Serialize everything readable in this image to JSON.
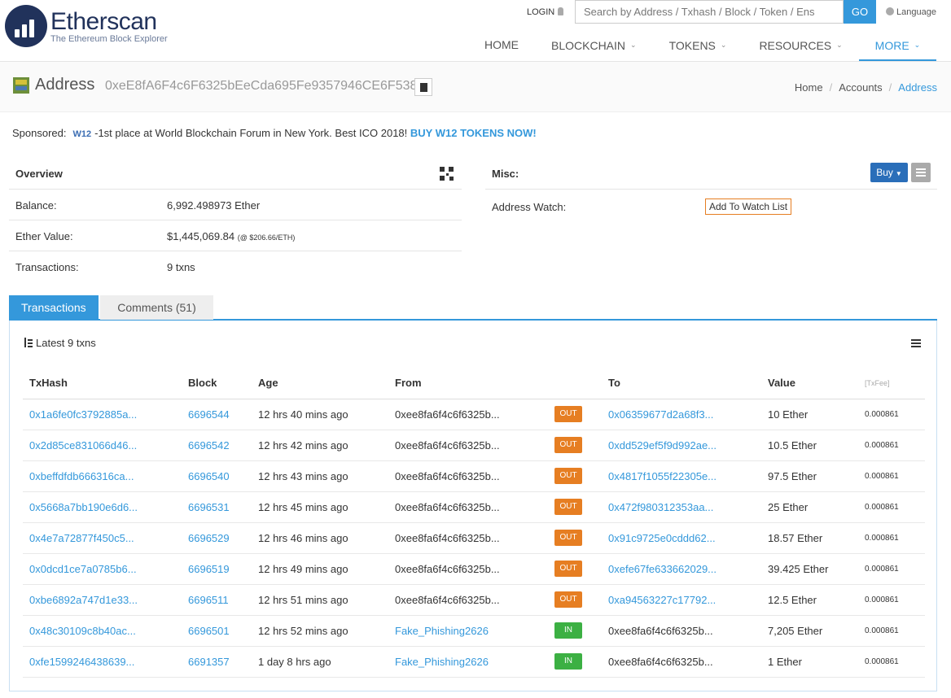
{
  "brand": {
    "name": "Etherscan",
    "tagline": "The Ethereum Block Explorer"
  },
  "header": {
    "login": "LOGIN",
    "search_placeholder": "Search by Address / Txhash / Block / Token / Ens",
    "go": "GO",
    "language": "Language",
    "nav": [
      "HOME",
      "BLOCKCHAIN",
      "TOKENS",
      "RESOURCES",
      "MORE"
    ]
  },
  "title": {
    "label": "Address",
    "hash": "0xeE8fA6F4c6F6325bEeCda695Fe9357946CE6F538",
    "crumbs": [
      "Home",
      "Accounts",
      "Address"
    ]
  },
  "sponsored": {
    "label": "Sponsored:",
    "brand": "W12",
    "text": "-1st place at World Blockchain Forum in New York. Best ICO 2018!",
    "cta": "BUY W12 TOKENS NOW!"
  },
  "overview": {
    "title": "Overview",
    "balance_label": "Balance:",
    "balance_value": "6,992.498973 Ether",
    "ether_value_label": "Ether Value:",
    "ether_value": "$1,445,069.84",
    "ether_rate": "(@ $206.66/ETH)",
    "transactions_label": "Transactions:",
    "transactions_value": "9 txns"
  },
  "misc": {
    "title": "Misc:",
    "buy": "Buy",
    "watch_label": "Address Watch:",
    "watch_button": "Add To Watch List"
  },
  "tabs": {
    "transactions": "Transactions",
    "comments": "Comments (51)"
  },
  "txlist": {
    "summary": "Latest 9 txns",
    "columns": [
      "TxHash",
      "Block",
      "Age",
      "From",
      "",
      "To",
      "Value",
      "[TxFee]"
    ],
    "rows": [
      {
        "hash": "0x1a6fe0fc3792885a...",
        "block": "6696544",
        "age": "12 hrs 40 mins ago",
        "from": "0xee8fa6f4c6f6325b...",
        "dir": "OUT",
        "to": "0x06359677d2a68f3...",
        "value": "10 Ether",
        "fee": "0.000861"
      },
      {
        "hash": "0x2d85ce831066d46...",
        "block": "6696542",
        "age": "12 hrs 42 mins ago",
        "from": "0xee8fa6f4c6f6325b...",
        "dir": "OUT",
        "to": "0xdd529ef5f9d992ae...",
        "value": "10.5 Ether",
        "fee": "0.000861"
      },
      {
        "hash": "0xbeffdfdb666316ca...",
        "block": "6696540",
        "age": "12 hrs 43 mins ago",
        "from": "0xee8fa6f4c6f6325b...",
        "dir": "OUT",
        "to": "0x4817f1055f22305e...",
        "value": "97.5 Ether",
        "fee": "0.000861"
      },
      {
        "hash": "0x5668a7bb190e6d6...",
        "block": "6696531",
        "age": "12 hrs 45 mins ago",
        "from": "0xee8fa6f4c6f6325b...",
        "dir": "OUT",
        "to": "0x472f980312353aa...",
        "value": "25 Ether",
        "fee": "0.000861"
      },
      {
        "hash": "0x4e7a72877f450c5...",
        "block": "6696529",
        "age": "12 hrs 46 mins ago",
        "from": "0xee8fa6f4c6f6325b...",
        "dir": "OUT",
        "to": "0x91c9725e0cddd62...",
        "value": "18.57 Ether",
        "fee": "0.000861"
      },
      {
        "hash": "0x0dcd1ce7a0785b6...",
        "block": "6696519",
        "age": "12 hrs 49 mins ago",
        "from": "0xee8fa6f4c6f6325b...",
        "dir": "OUT",
        "to": "0xefe67fe633662029...",
        "value": "39.425 Ether",
        "fee": "0.000861"
      },
      {
        "hash": "0xbe6892a747d1e33...",
        "block": "6696511",
        "age": "12 hrs 51 mins ago",
        "from": "0xee8fa6f4c6f6325b...",
        "dir": "OUT",
        "to": "0xa94563227c17792...",
        "value": "12.5 Ether",
        "fee": "0.000861"
      },
      {
        "hash": "0x48c30109c8b40ac...",
        "block": "6696501",
        "age": "12 hrs 52 mins ago",
        "from": "Fake_Phishing2626",
        "dir": "IN",
        "to": "0xee8fa6f4c6f6325b...",
        "value": "7,205 Ether",
        "fee": "0.000861"
      },
      {
        "hash": "0xfe1599246438639...",
        "block": "6691357",
        "age": "1 day 8 hrs ago",
        "from": "Fake_Phishing2626",
        "dir": "IN",
        "to": "0xee8fa6f4c6f6325b...",
        "value": "1 Ether",
        "fee": "0.000861"
      }
    ]
  },
  "colors": {
    "accent": "#3498db",
    "out_badge": "#e67e22",
    "in_badge": "#3cb043",
    "brand_dark": "#21325b"
  }
}
